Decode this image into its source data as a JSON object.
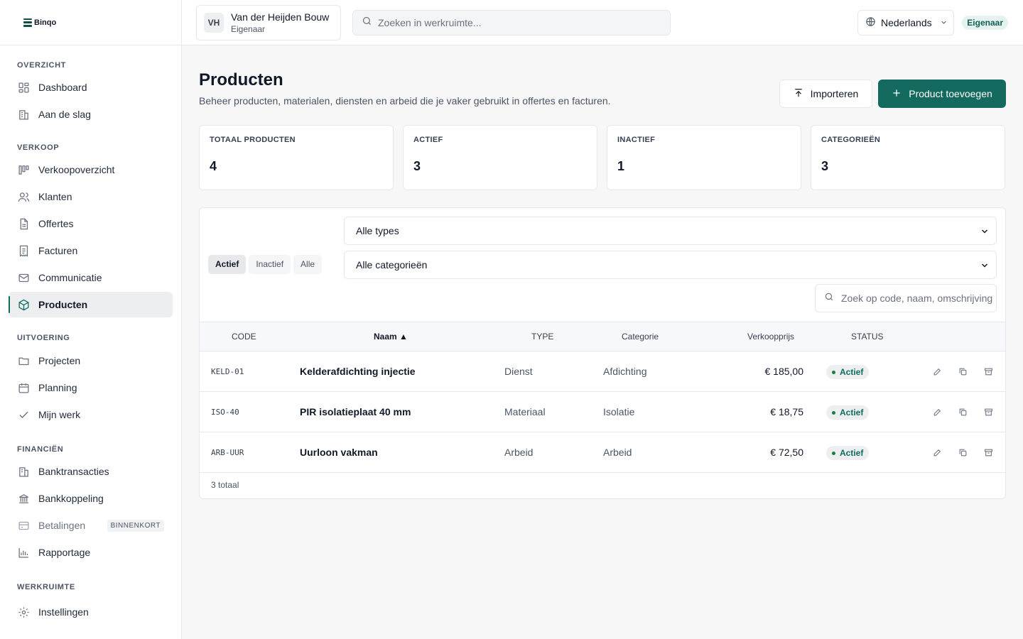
{
  "brand": {
    "name": "Binqo"
  },
  "header": {
    "workspace": {
      "initials": "VH",
      "name": "Van der Heijden Bouw",
      "role": "Eigenaar"
    },
    "search_placeholder": "Zoeken in werkruimte...",
    "language": "Nederlands",
    "role_badge": "Eigenaar"
  },
  "sidebar": {
    "sections": [
      {
        "title": "OVERZICHT",
        "items": [
          {
            "label": "Dashboard",
            "icon": "dashboard-icon"
          },
          {
            "label": "Aan de slag",
            "icon": "building-icon"
          }
        ]
      },
      {
        "title": "VERKOOP",
        "items": [
          {
            "label": "Verkoopoverzicht",
            "icon": "kanban-icon"
          },
          {
            "label": "Klanten",
            "icon": "users-icon"
          },
          {
            "label": "Offertes",
            "icon": "document-icon"
          },
          {
            "label": "Facturen",
            "icon": "receipt-icon"
          },
          {
            "label": "Communicatie",
            "icon": "mail-icon"
          },
          {
            "label": "Producten",
            "icon": "box-icon",
            "active": true
          }
        ]
      },
      {
        "title": "UITVOERING",
        "items": [
          {
            "label": "Projecten",
            "icon": "folder-icon"
          },
          {
            "label": "Planning",
            "icon": "calendar-icon"
          },
          {
            "label": "Mijn werk",
            "icon": "check-icon"
          }
        ]
      },
      {
        "title": "FINANCIËN",
        "items": [
          {
            "label": "Banktransacties",
            "icon": "bank-transactions-icon"
          },
          {
            "label": "Bankkoppeling",
            "icon": "bank-icon"
          },
          {
            "label": "Betalingen",
            "icon": "credit-card-icon",
            "badge": "BINNENKORT"
          },
          {
            "label": "Rapportage",
            "icon": "bar-chart-icon"
          }
        ]
      },
      {
        "title": "WERKRUIMTE",
        "items": [
          {
            "label": "Instellingen",
            "icon": "gear-icon"
          }
        ]
      }
    ]
  },
  "page": {
    "title": "Producten",
    "subtitle": "Beheer producten, materialen, diensten en arbeid die je vaker gebruikt in offertes en facturen.",
    "import_label": "Importeren",
    "add_label": "Product toevoegen"
  },
  "stats": [
    {
      "label": "TOTAAL PRODUCTEN",
      "value": "4"
    },
    {
      "label": "ACTIEF",
      "value": "3"
    },
    {
      "label": "INACTIEF",
      "value": "1"
    },
    {
      "label": "CATEGORIEËN",
      "value": "3"
    }
  ],
  "filters": {
    "segments": [
      "Actief",
      "Inactief",
      "Alle"
    ],
    "active_segment": "Actief",
    "type_select": "Alle types",
    "category_select": "Alle categorieën",
    "search_placeholder": "Zoek op code, naam, omschrijving"
  },
  "table": {
    "headers": {
      "code": "CODE",
      "name": "Naam ▲",
      "type": "TYPE",
      "category": "Categorie",
      "price": "Verkoopprijs",
      "status": "STATUS"
    },
    "rows": [
      {
        "code": "KELD-01",
        "name": "Kelderafdichting injectie",
        "type": "Dienst",
        "category": "Afdichting",
        "price": "€ 185,00",
        "status": "Actief"
      },
      {
        "code": "ISO-40",
        "name": "PIR isolatieplaat 40 mm",
        "type": "Materiaal",
        "category": "Isolatie",
        "price": "€ 18,75",
        "status": "Actief"
      },
      {
        "code": "ARB-UUR",
        "name": "Uurloon vakman",
        "type": "Arbeid",
        "category": "Arbeid",
        "price": "€ 72,50",
        "status": "Actief"
      }
    ],
    "footer": "3 totaal"
  },
  "colors": {
    "accent": "#146a5e",
    "status_text": "#0f6b5f",
    "status_dot": "#15803d"
  }
}
